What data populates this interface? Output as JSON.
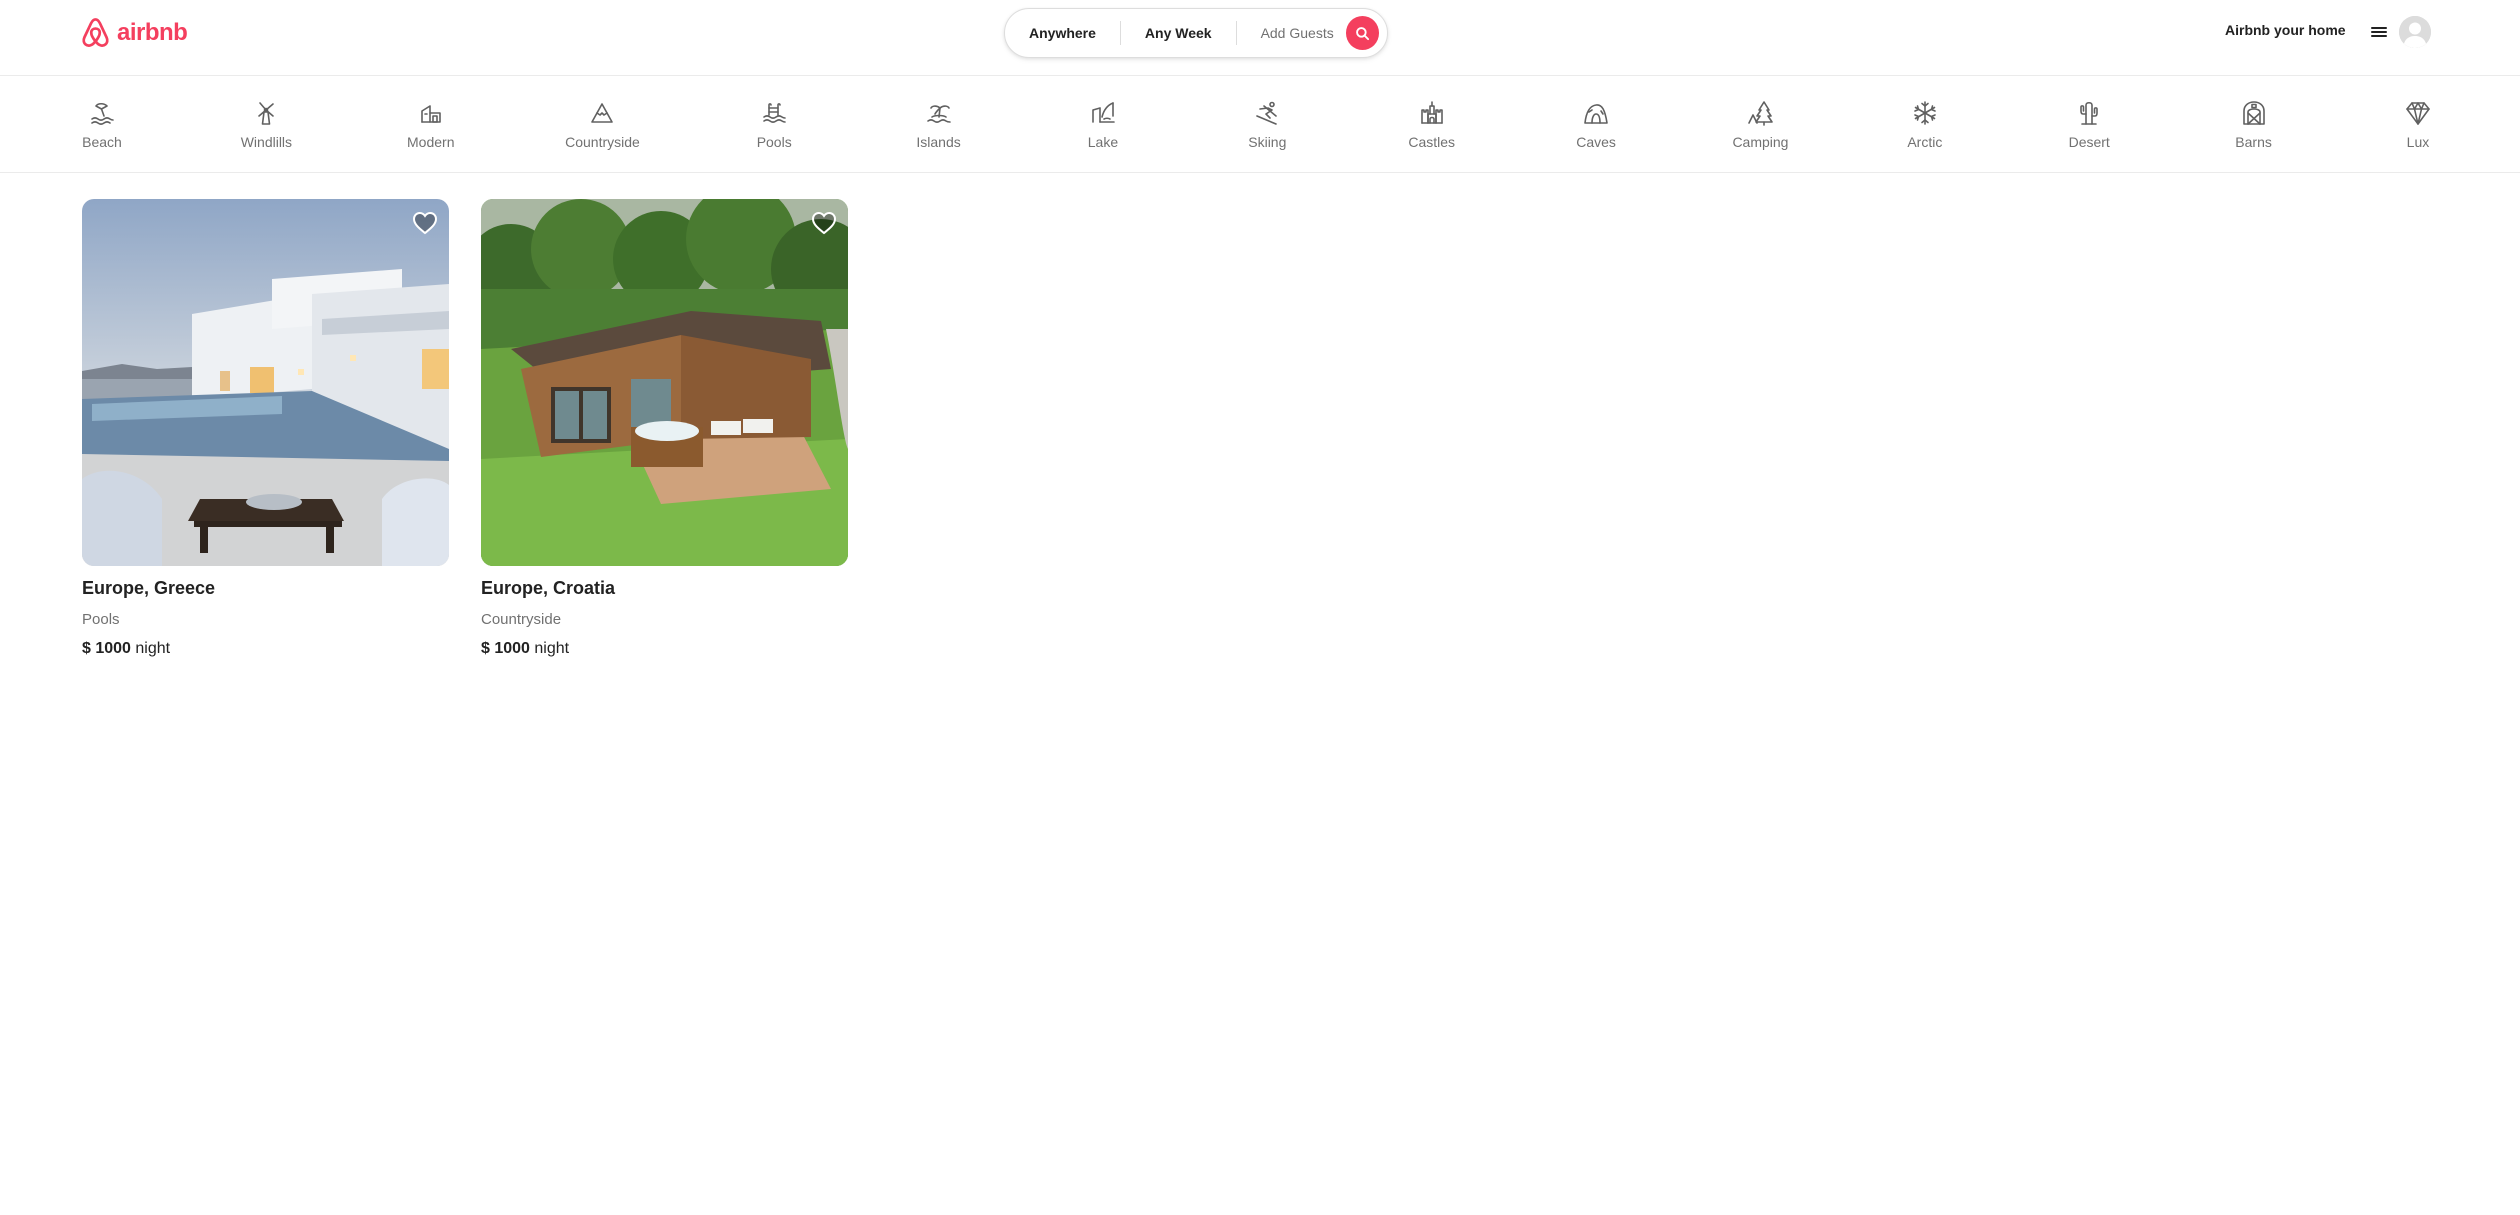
{
  "brand": {
    "name": "airbnb",
    "color": "#f43f5e"
  },
  "search": {
    "where": "Anywhere",
    "when": "Any Week",
    "guests": "Add Guests"
  },
  "header": {
    "host_link": "Airbnb your home"
  },
  "categories": [
    {
      "label": "Beach",
      "icon": "beach-icon"
    },
    {
      "label": "Windlills",
      "icon": "windmill-icon"
    },
    {
      "label": "Modern",
      "icon": "modern-icon"
    },
    {
      "label": "Countryside",
      "icon": "mountain-icon"
    },
    {
      "label": "Pools",
      "icon": "pool-icon"
    },
    {
      "label": "Islands",
      "icon": "island-icon"
    },
    {
      "label": "Lake",
      "icon": "lake-icon"
    },
    {
      "label": "Skiing",
      "icon": "skiing-icon"
    },
    {
      "label": "Castles",
      "icon": "castle-icon"
    },
    {
      "label": "Caves",
      "icon": "cave-icon"
    },
    {
      "label": "Camping",
      "icon": "camping-icon"
    },
    {
      "label": "Arctic",
      "icon": "snowflake-icon"
    },
    {
      "label": "Desert",
      "icon": "cactus-icon"
    },
    {
      "label": "Barns",
      "icon": "barn-icon"
    },
    {
      "label": "Lux",
      "icon": "diamond-icon"
    }
  ],
  "listings": [
    {
      "location": "Europe, Greece",
      "category": "Pools",
      "currency": "$",
      "price": "1000",
      "unit": "night"
    },
    {
      "location": "Europe, Croatia",
      "category": "Countryside",
      "currency": "$",
      "price": "1000",
      "unit": "night"
    }
  ]
}
